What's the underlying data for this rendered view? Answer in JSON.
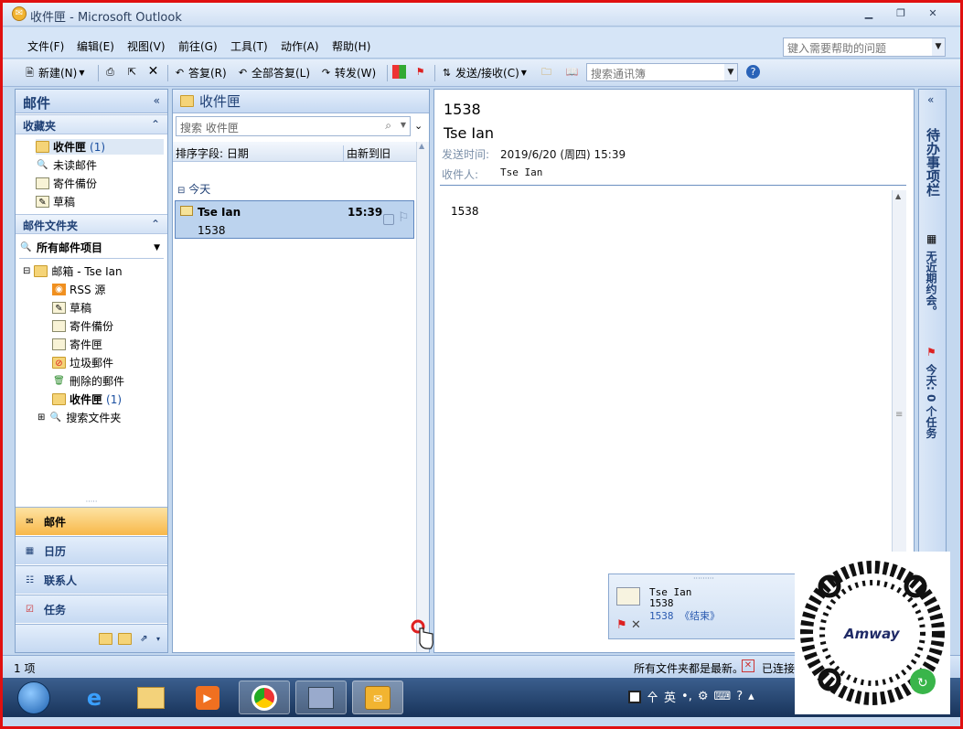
{
  "window": {
    "title": "收件匣 - Microsoft Outlook",
    "min": "▁",
    "max": "❐",
    "close": "✕"
  },
  "menu": {
    "items": [
      "文件(F)",
      "编辑(E)",
      "视图(V)",
      "前往(G)",
      "工具(T)",
      "动作(A)",
      "帮助(H)"
    ],
    "help_placeholder": "键入需要帮助的问题"
  },
  "toolbar": {
    "new": "新建(N)",
    "reply": "答复(R)",
    "reply_all": "全部答复(L)",
    "forward": "转发(W)",
    "send_receive": "发送/接收(C)",
    "search_contacts": "搜索通讯簿"
  },
  "nav": {
    "title": "邮件",
    "favorites_title": "收藏夹",
    "favorites": [
      {
        "label": "收件匣",
        "count": "(1)"
      },
      {
        "label": "未读邮件"
      },
      {
        "label": "寄件備份"
      },
      {
        "label": "草稿"
      }
    ],
    "folders_title": "邮件文件夹",
    "all_items": "所有邮件项目",
    "mailbox": "邮箱 - Tse Ian",
    "folders": [
      {
        "label": "RSS 源"
      },
      {
        "label": "草稿"
      },
      {
        "label": "寄件備份"
      },
      {
        "label": "寄件匣"
      },
      {
        "label": "垃圾郵件"
      },
      {
        "label": "刪除的郵件"
      },
      {
        "label": "收件匣",
        "count": "(1)"
      }
    ],
    "search_folders": "搜索文件夹",
    "buttons": [
      "邮件",
      "日历",
      "联系人",
      "任务"
    ]
  },
  "list": {
    "title": "收件匣",
    "search_placeholder": "搜索 收件匣",
    "sort_label": "排序字段: 日期",
    "sort_order": "由新到旧",
    "group": "今天",
    "messages": [
      {
        "from": "Tse Ian",
        "time": "15:39",
        "subject": "1538"
      }
    ]
  },
  "reading": {
    "subject": "1538",
    "from": "Tse Ian",
    "sent_label": "发送时间:",
    "sent_value": "2019/6/20 (周四) 15:39",
    "to_label": "收件人:",
    "to_value": "Tse Ian",
    "body": "1538"
  },
  "todo": {
    "title": "待办事项栏",
    "appointments": "无近期约会。",
    "tasks": "今天: 0 个任务"
  },
  "alert": {
    "from": "Tse Ian",
    "subject": "1538",
    "preview": "1538 《结束》"
  },
  "status": {
    "count": "1 项",
    "folders": "所有文件夹都是最新。",
    "connected": "已连接"
  },
  "taskbar": {
    "ime": "英"
  },
  "qr": {
    "brand": "Amway"
  }
}
